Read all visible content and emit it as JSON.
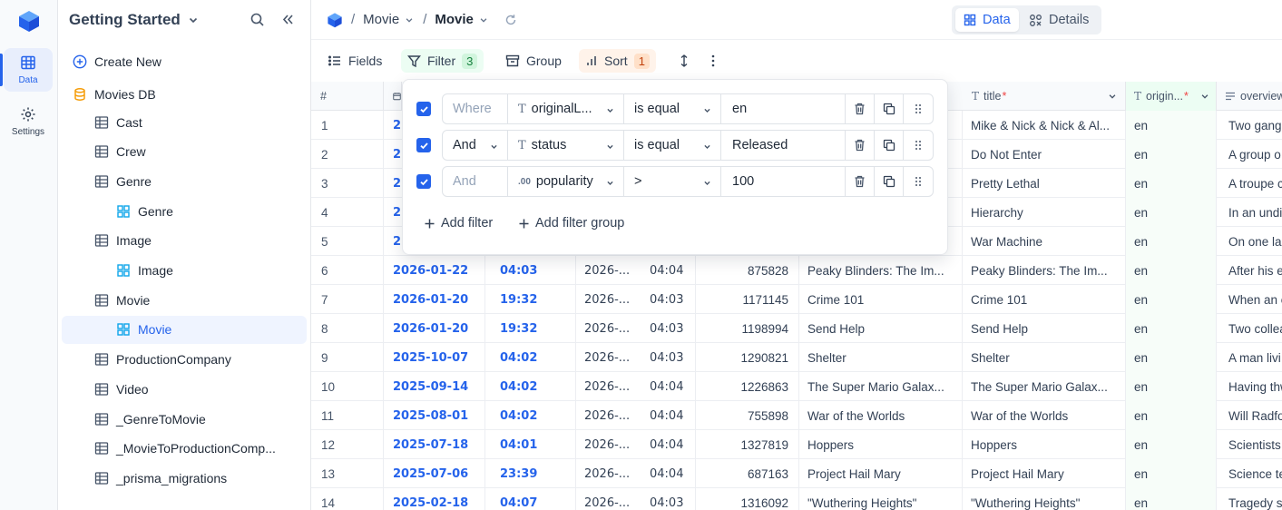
{
  "rail": {
    "items": [
      {
        "label": "Data",
        "icon": "table-icon",
        "active": true
      },
      {
        "label": "Settings",
        "icon": "gear-icon",
        "active": false
      }
    ]
  },
  "sidebar": {
    "workspace": "Getting Started",
    "create_new": "Create New",
    "database": "Movies DB",
    "tables": [
      {
        "label": "Cast",
        "level": 1,
        "kind": "table"
      },
      {
        "label": "Crew",
        "level": 1,
        "kind": "table"
      },
      {
        "label": "Genre",
        "level": 1,
        "kind": "table"
      },
      {
        "label": "Genre",
        "level": 2,
        "kind": "view"
      },
      {
        "label": "Image",
        "level": 1,
        "kind": "table"
      },
      {
        "label": "Image",
        "level": 2,
        "kind": "view"
      },
      {
        "label": "Movie",
        "level": 1,
        "kind": "table"
      },
      {
        "label": "Movie",
        "level": 2,
        "kind": "view",
        "selected": true
      },
      {
        "label": "ProductionCompany",
        "level": 1,
        "kind": "table"
      },
      {
        "label": "Video",
        "level": 1,
        "kind": "table"
      },
      {
        "label": "_GenreToMovie",
        "level": 1,
        "kind": "table"
      },
      {
        "label": "_MovieToProductionComp...",
        "level": 1,
        "kind": "table"
      },
      {
        "label": "_prisma_migrations",
        "level": 1,
        "kind": "table"
      }
    ]
  },
  "breadcrumb": {
    "sep": "/",
    "table": "Movie",
    "view": "Movie"
  },
  "view_toggle": {
    "data": "Data",
    "details": "Details"
  },
  "toolbar": {
    "fields": "Fields",
    "filter": "Filter",
    "filter_count": "3",
    "group": "Group",
    "sort": "Sort",
    "sort_count": "1"
  },
  "grid": {
    "headers": {
      "num": "#",
      "title": "title",
      "original": "origin...",
      "overview": "overview"
    },
    "rows": [
      {
        "n": "1",
        "date": "2",
        "time": "",
        "up": "",
        "upt": "",
        "id": "",
        "ot": "",
        "title": "Mike & Nick & Nick & Al...",
        "lang": "en",
        "ov": "Two gang"
      },
      {
        "n": "2",
        "date": "2",
        "time": "",
        "up": "",
        "upt": "",
        "id": "",
        "ot": "",
        "title": "Do Not Enter",
        "lang": "en",
        "ov": "A group o"
      },
      {
        "n": "3",
        "date": "2",
        "time": "",
        "up": "",
        "upt": "",
        "id": "",
        "ot": "",
        "title": "Pretty Lethal",
        "lang": "en",
        "ov": "A troupe c"
      },
      {
        "n": "4",
        "date": "2",
        "time": "",
        "up": "",
        "upt": "",
        "id": "",
        "ot": "",
        "title": "Hierarchy",
        "lang": "en",
        "ov": "In an undi"
      },
      {
        "n": "5",
        "date": "2",
        "time": "",
        "up": "",
        "upt": "",
        "id": "",
        "ot": "",
        "title": "War Machine",
        "lang": "en",
        "ov": "On one las"
      },
      {
        "n": "6",
        "date": "2026-01-22",
        "time": "04:03",
        "up": "2026-...",
        "upt": "04:04",
        "id": "875828",
        "ot": "Peaky Blinders: The Im...",
        "title": "Peaky Blinders: The Im...",
        "lang": "en",
        "ov": "After his e"
      },
      {
        "n": "7",
        "date": "2026-01-20",
        "time": "19:32",
        "up": "2026-...",
        "upt": "04:03",
        "id": "1171145",
        "ot": "Crime 101",
        "title": "Crime 101",
        "lang": "en",
        "ov": "When an e"
      },
      {
        "n": "8",
        "date": "2026-01-20",
        "time": "19:32",
        "up": "2026-...",
        "upt": "04:03",
        "id": "1198994",
        "ot": "Send Help",
        "title": "Send Help",
        "lang": "en",
        "ov": "Two collea"
      },
      {
        "n": "9",
        "date": "2025-10-07",
        "time": "04:02",
        "up": "2026-...",
        "upt": "04:03",
        "id": "1290821",
        "ot": "Shelter",
        "title": "Shelter",
        "lang": "en",
        "ov": "A man livi"
      },
      {
        "n": "10",
        "date": "2025-09-14",
        "time": "04:02",
        "up": "2026-...",
        "upt": "04:04",
        "id": "1226863",
        "ot": "The Super Mario Galax...",
        "title": "The Super Mario Galax...",
        "lang": "en",
        "ov": "Having thw"
      },
      {
        "n": "11",
        "date": "2025-08-01",
        "time": "04:02",
        "up": "2026-...",
        "upt": "04:04",
        "id": "755898",
        "ot": "War of the Worlds",
        "title": "War of the Worlds",
        "lang": "en",
        "ov": "Will Radfo"
      },
      {
        "n": "12",
        "date": "2025-07-18",
        "time": "04:01",
        "up": "2026-...",
        "upt": "04:04",
        "id": "1327819",
        "ot": "Hoppers",
        "title": "Hoppers",
        "lang": "en",
        "ov": "Scientists"
      },
      {
        "n": "13",
        "date": "2025-07-06",
        "time": "23:39",
        "up": "2026-...",
        "upt": "04:04",
        "id": "687163",
        "ot": "Project Hail Mary",
        "title": "Project Hail Mary",
        "lang": "en",
        "ov": "Science te"
      },
      {
        "n": "14",
        "date": "2025-02-18",
        "time": "04:07",
        "up": "2026-...",
        "upt": "04:03",
        "id": "1316092",
        "ot": "\"Wuthering Heights\"",
        "title": "\"Wuthering Heights\"",
        "lang": "en",
        "ov": "Tragedy s"
      }
    ]
  },
  "filter_popover": {
    "filters": [
      {
        "conj": "Where",
        "conj_dropdown": false,
        "field": "originalL...",
        "field_icon": "text-type-icon",
        "op": "is equal",
        "value": "en"
      },
      {
        "conj": "And",
        "conj_dropdown": true,
        "field": "status",
        "field_icon": "text-type-icon",
        "op": "is equal",
        "value": "Released"
      },
      {
        "conj": "And",
        "conj_dropdown": false,
        "field": "popularity",
        "field_icon": "decimal-type-icon",
        "op": ">",
        "value": "100"
      }
    ],
    "add_filter": "Add filter",
    "add_group": "Add filter group"
  }
}
